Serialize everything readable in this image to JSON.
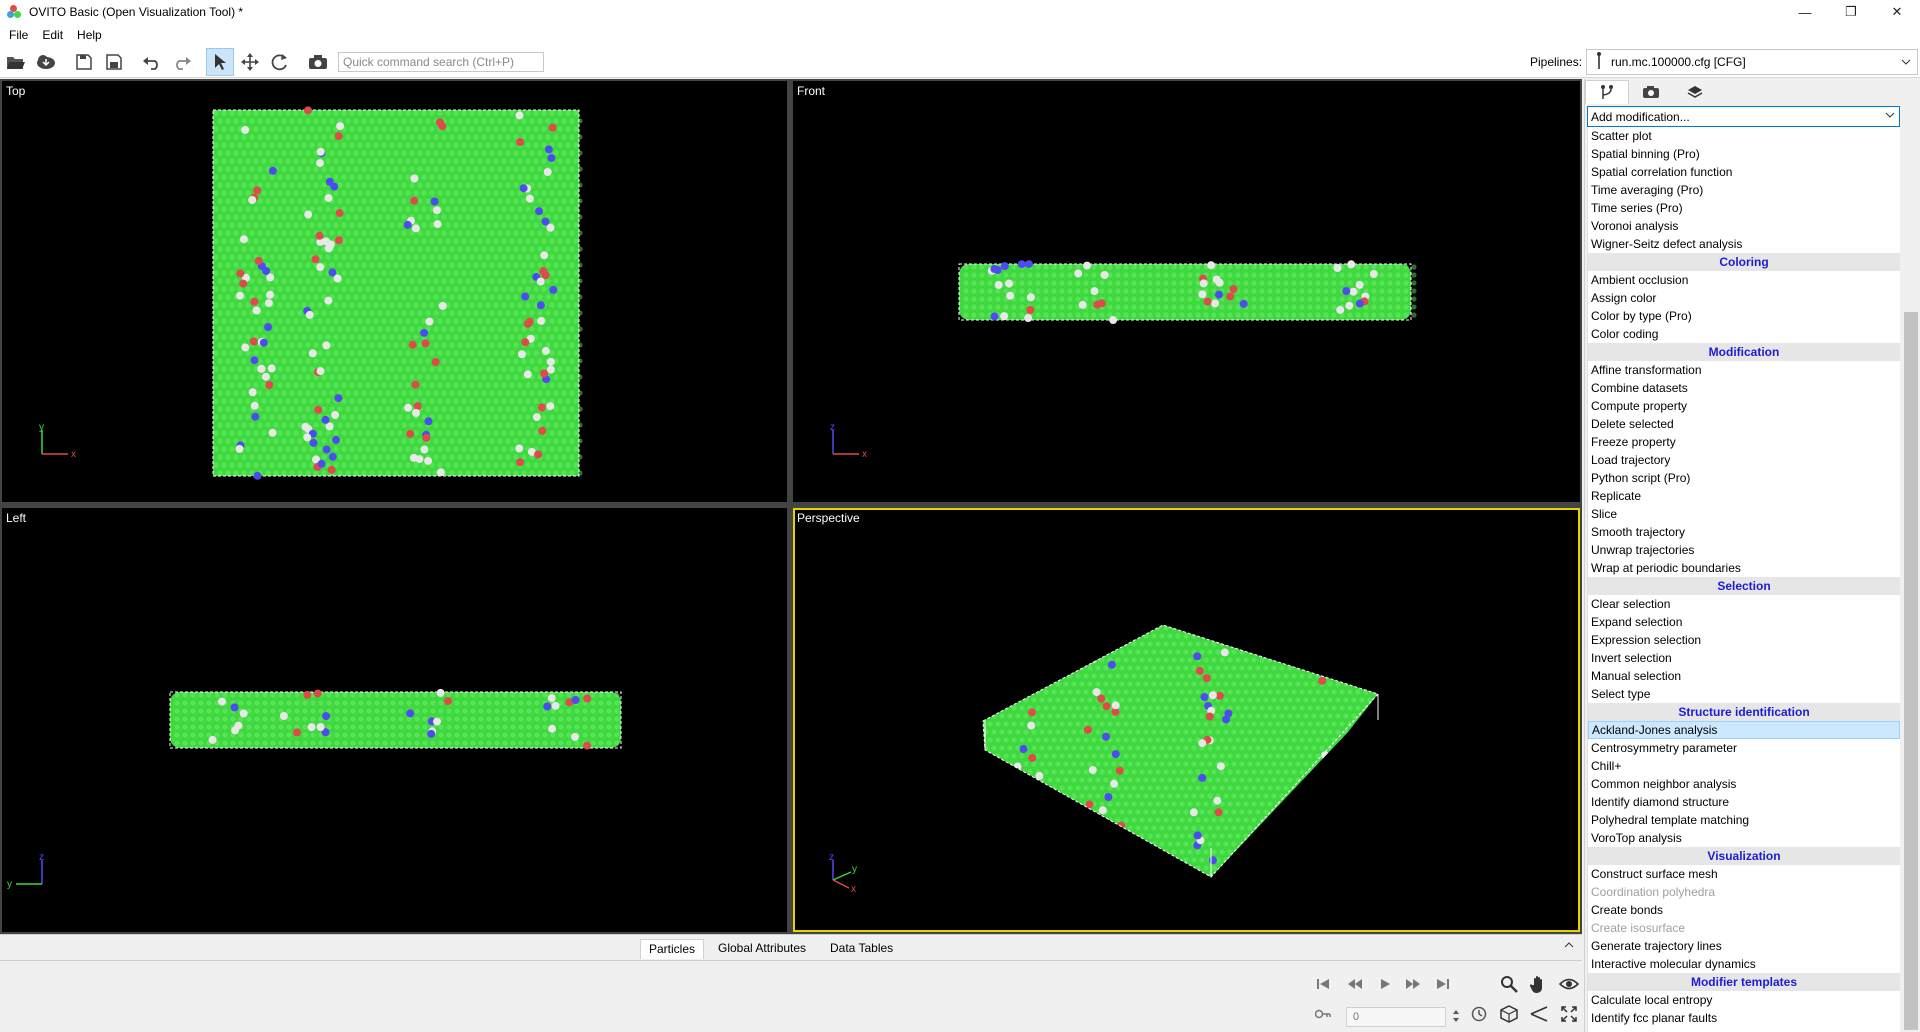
{
  "window": {
    "title": "OVITO Basic (Open Visualization Tool) *",
    "minimize_glyph": "—",
    "maximize_glyph": "❐",
    "close_glyph": "✕"
  },
  "menu": [
    "File",
    "Edit",
    "Help"
  ],
  "toolbar": {
    "search_placeholder": "Quick command search (Ctrl+P)",
    "pipelines_label": "Pipelines:",
    "pipeline_value": "run.mc.100000.cfg [CFG]"
  },
  "viewports": {
    "top": "Top",
    "front": "Front",
    "left": "Left",
    "perspective": "Perspective"
  },
  "axes": {
    "x": "x",
    "y": "y",
    "z": "z"
  },
  "colors": {
    "atom_green": "#3fd93f",
    "atom_red": "#e04a4a",
    "atom_blue": "#4c4cf0",
    "atom_white": "#e8e8e8",
    "active_viewport": "#e6d200",
    "section_header": "#1c1cd6"
  },
  "bottom_tabs": [
    "Particles",
    "Global Attributes",
    "Data Tables"
  ],
  "animation": {
    "frame": "0"
  },
  "panel": {
    "add_modification": "Add modification...",
    "sections": [
      {
        "header": "",
        "items": [
          {
            "label": "Scatter plot"
          },
          {
            "label": "Spatial binning (Pro)"
          },
          {
            "label": "Spatial correlation function"
          },
          {
            "label": "Time averaging (Pro)"
          },
          {
            "label": "Time series (Pro)"
          },
          {
            "label": "Voronoi analysis"
          },
          {
            "label": "Wigner-Seitz defect analysis"
          }
        ]
      },
      {
        "header": "Coloring",
        "items": [
          {
            "label": "Ambient occlusion"
          },
          {
            "label": "Assign color"
          },
          {
            "label": "Color by type (Pro)"
          },
          {
            "label": "Color coding"
          }
        ]
      },
      {
        "header": "Modification",
        "items": [
          {
            "label": "Affine transformation"
          },
          {
            "label": "Combine datasets"
          },
          {
            "label": "Compute property"
          },
          {
            "label": "Delete selected"
          },
          {
            "label": "Freeze property"
          },
          {
            "label": "Load trajectory"
          },
          {
            "label": "Python script (Pro)"
          },
          {
            "label": "Replicate"
          },
          {
            "label": "Slice"
          },
          {
            "label": "Smooth trajectory"
          },
          {
            "label": "Unwrap trajectories"
          },
          {
            "label": "Wrap at periodic boundaries"
          }
        ]
      },
      {
        "header": "Selection",
        "items": [
          {
            "label": "Clear selection"
          },
          {
            "label": "Expand selection"
          },
          {
            "label": "Expression selection"
          },
          {
            "label": "Invert selection"
          },
          {
            "label": "Manual selection"
          },
          {
            "label": "Select type"
          }
        ]
      },
      {
        "header": "Structure identification",
        "items": [
          {
            "label": "Ackland-Jones analysis",
            "selected": true
          },
          {
            "label": "Centrosymmetry parameter"
          },
          {
            "label": "Chill+"
          },
          {
            "label": "Common neighbor analysis"
          },
          {
            "label": "Identify diamond structure"
          },
          {
            "label": "Polyhedral template matching"
          },
          {
            "label": "VoroTop analysis"
          }
        ]
      },
      {
        "header": "Visualization",
        "items": [
          {
            "label": "Construct surface mesh"
          },
          {
            "label": "Coordination polyhedra",
            "disabled": true
          },
          {
            "label": "Create bonds"
          },
          {
            "label": "Create isosurface",
            "disabled": true
          },
          {
            "label": "Generate trajectory lines"
          },
          {
            "label": "Interactive molecular dynamics"
          }
        ]
      },
      {
        "header": "Modifier templates",
        "items": [
          {
            "label": "Calculate local entropy"
          },
          {
            "label": "Identify fcc planar faults"
          }
        ]
      }
    ]
  }
}
